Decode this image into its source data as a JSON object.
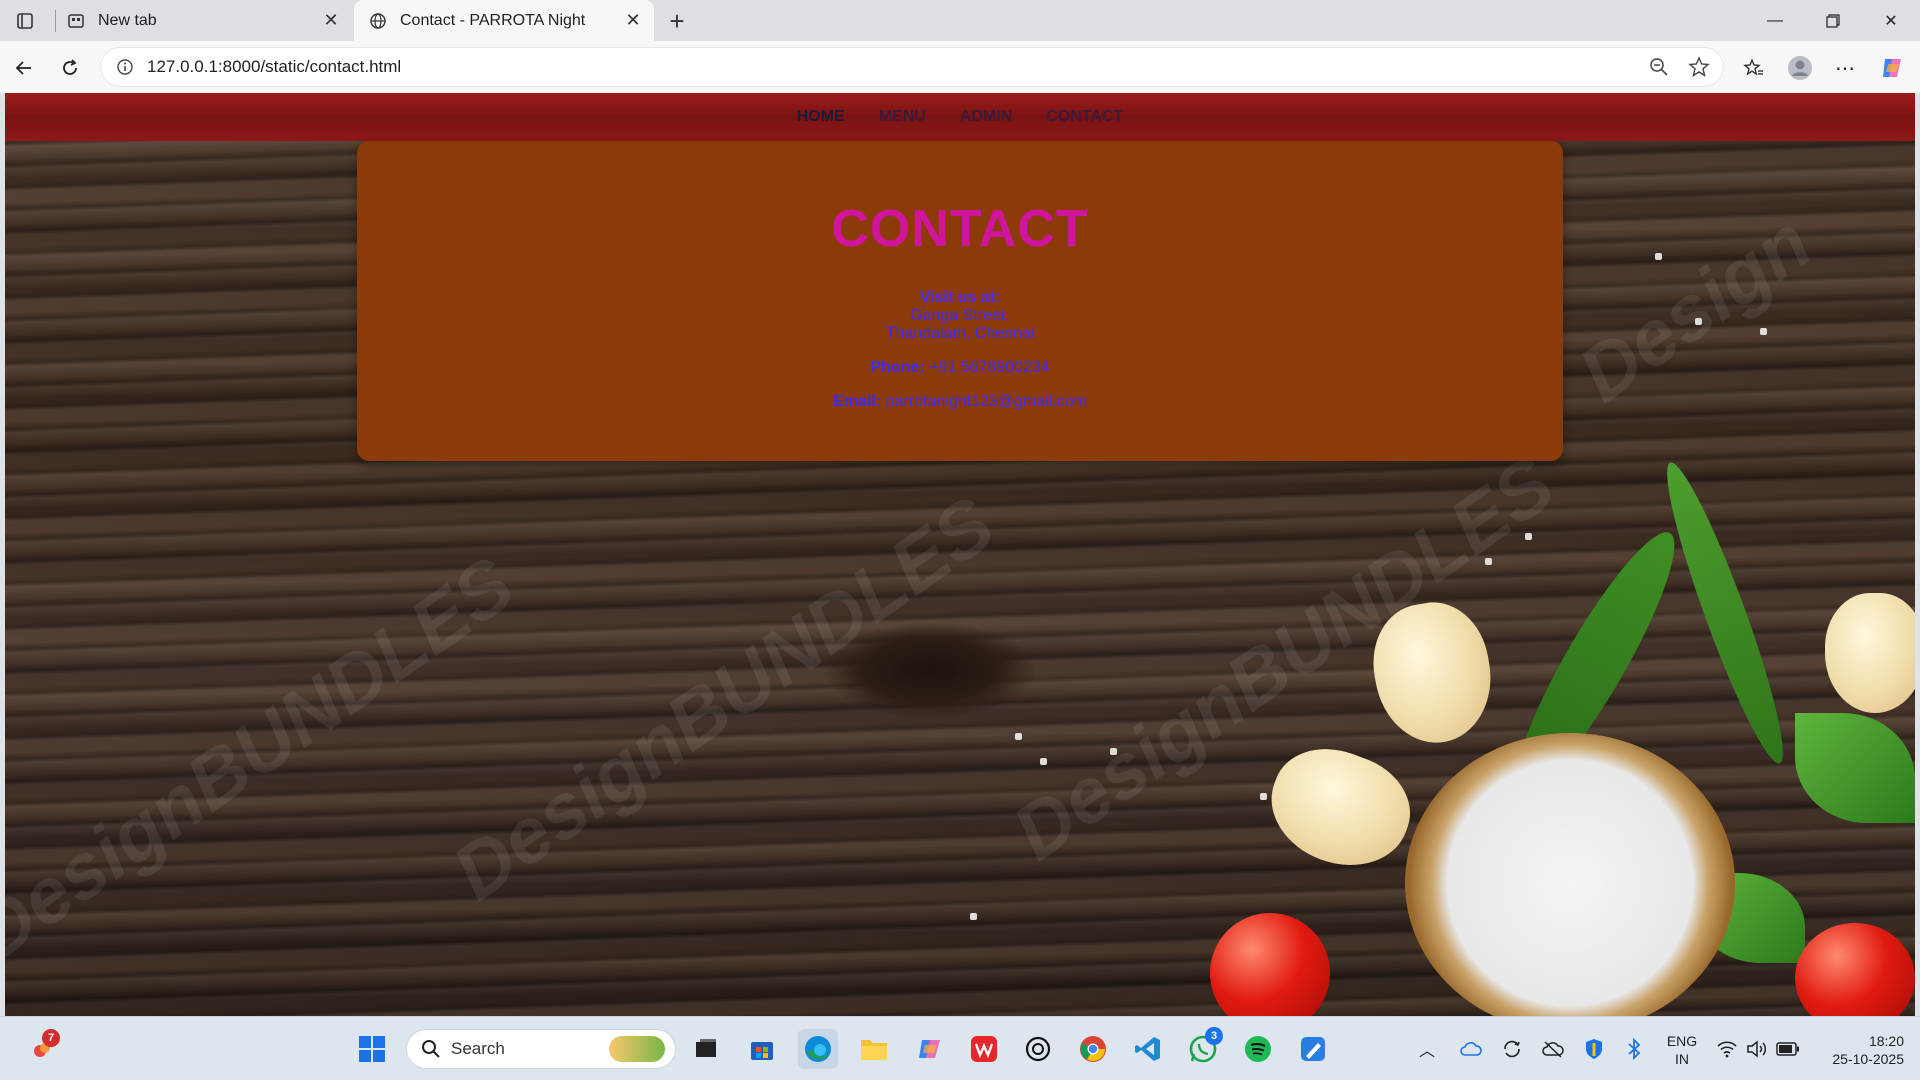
{
  "browser": {
    "tabs": [
      {
        "label": "New tab",
        "icon": "new-tab-icon",
        "active": false
      },
      {
        "label": "Contact - PARROTA Night",
        "icon": "globe-icon",
        "active": true
      }
    ],
    "url": "127.0.0.1:8000/static/contact.html"
  },
  "page": {
    "nav": [
      {
        "label": "HOME"
      },
      {
        "label": "MENU"
      },
      {
        "label": "ADMIN"
      },
      {
        "label": "CONTACT"
      }
    ],
    "heading": "CONTACT",
    "visit_label": "Visit us at:",
    "address_line1": "Ganga Street,",
    "address_line2": "Thandalam, Chennai",
    "phone_label": "Phone:",
    "phone": "+91 5678900234",
    "email_label": "Email:",
    "email": "parrotanight123@gmail.com",
    "colors": {
      "navbar": "#8d1818",
      "card": "#8c3a07",
      "heading": "#d0149d",
      "text": "#3f2bff"
    }
  },
  "taskbar": {
    "search_placeholder": "Search",
    "notification_count": "7",
    "whatsapp_badge": "3",
    "language": "ENG",
    "region": "IN",
    "time": "18:20",
    "date": "25-10-2025"
  }
}
